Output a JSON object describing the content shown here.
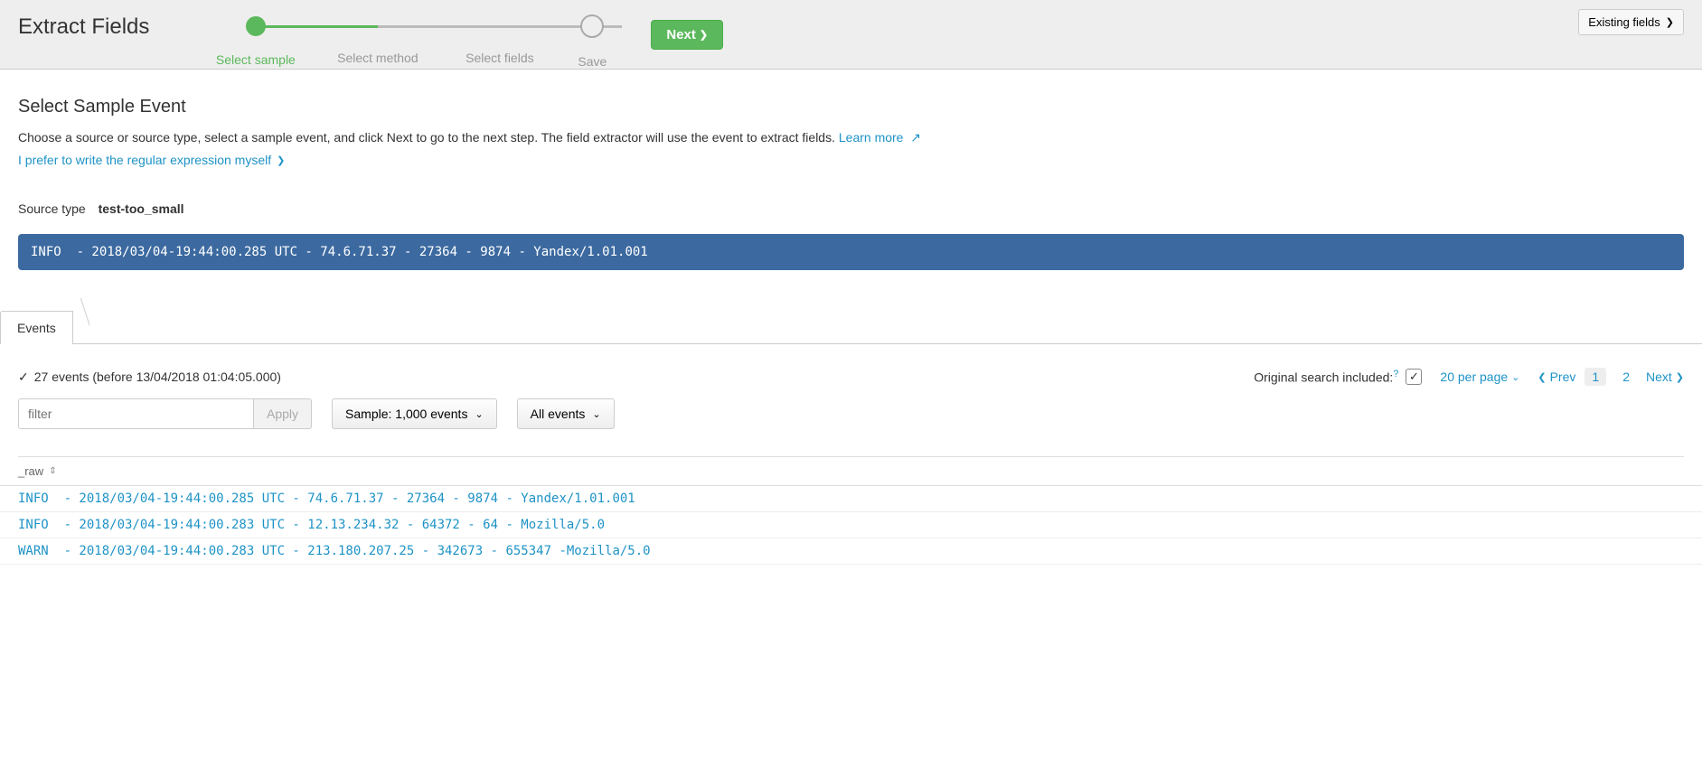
{
  "header": {
    "title": "Extract Fields",
    "steps": [
      "Select sample",
      "Select method",
      "Select fields",
      "Save"
    ],
    "next_button": "Next",
    "existing_fields_button": "Existing fields"
  },
  "section": {
    "title": "Select Sample Event",
    "intro": "Choose a source or source type, select a sample event, and click Next to go to the next step. The field extractor will use the event to extract fields.",
    "learn_more": "Learn more",
    "regex_link": "I prefer to write the regular expression myself",
    "source_type_label": "Source type",
    "source_type_value": "test-too_small",
    "sample_event": "INFO  - 2018/03/04-19:44:00.285 UTC - 74.6.71.37 - 27364 - 9874 - Yandex/1.01.001"
  },
  "tabs": {
    "events": "Events"
  },
  "events": {
    "count_text": "27 events (before 13/04/2018 01:04:05.000)",
    "original_search_label": "Original search included:",
    "original_search_checked": true,
    "per_page_label": "20 per page",
    "pager": {
      "prev": "Prev",
      "pages": [
        "1",
        "2"
      ],
      "current": "1",
      "next": "Next"
    },
    "filter_placeholder": "filter",
    "apply_label": "Apply",
    "sample_dropdown": "Sample: 1,000 events",
    "allevents_dropdown": "All events",
    "column_header": "_raw",
    "rows": [
      "INFO  - 2018/03/04-19:44:00.285 UTC - 74.6.71.37 - 27364 - 9874 - Yandex/1.01.001",
      "INFO  - 2018/03/04-19:44:00.283 UTC - 12.13.234.32 - 64372 - 64 - Mozilla/5.0",
      "WARN  - 2018/03/04-19:44:00.283 UTC - 213.180.207.25 - 342673 - 655347 -Mozilla/5.0"
    ]
  }
}
